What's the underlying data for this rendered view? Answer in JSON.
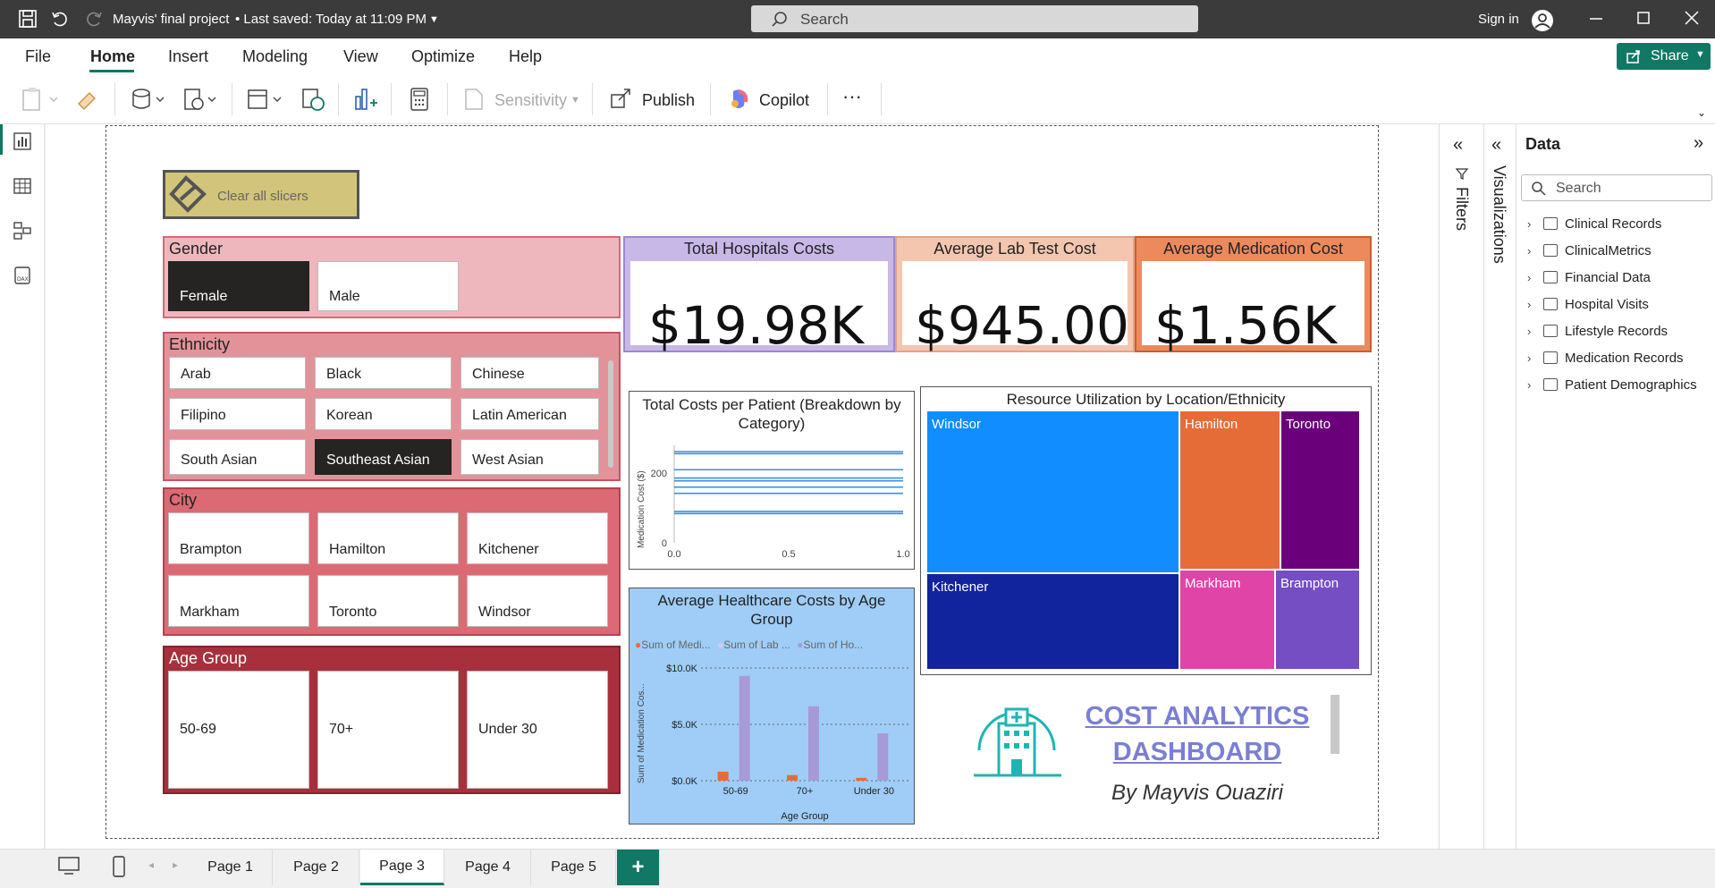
{
  "titlebar": {
    "doc_title": "Mayvis' final project",
    "saved": "• Last saved: Today at 11:09 PM",
    "search_placeholder": "Search",
    "sign_in": "Sign in"
  },
  "menu": {
    "items": [
      "File",
      "Home",
      "Insert",
      "Modeling",
      "View",
      "Optimize",
      "Help"
    ],
    "active": "Home",
    "share_label": "Share"
  },
  "ribbon": {
    "sensitivity": "Sensitivity",
    "publish": "Publish",
    "copilot": "Copilot",
    "more": "···"
  },
  "canvas": {
    "clear_slicers": "Clear all slicers",
    "gender": {
      "title": "Gender",
      "options": [
        "Female",
        "Male"
      ],
      "selected": "Female"
    },
    "ethnicity": {
      "title": "Ethnicity",
      "options": [
        "Arab",
        "Black",
        "Chinese",
        "Filipino",
        "Korean",
        "Latin American",
        "South Asian",
        "Southeast Asian",
        "West Asian"
      ],
      "selected": "Southeast Asian"
    },
    "city": {
      "title": "City",
      "options": [
        "Brampton",
        "Hamilton",
        "Kitchener",
        "Markham",
        "Toronto",
        "Windsor"
      ]
    },
    "age_group": {
      "title": "Age Group",
      "options": [
        "50-69",
        "70+",
        "Under 30"
      ]
    },
    "kpis": [
      {
        "title": "Total Hospitals Costs",
        "value": "$19.98K",
        "color": "#c8b8e8"
      },
      {
        "title": "Average Lab Test Cost",
        "value": "$945.00",
        "color": "#f4c6b0"
      },
      {
        "title": "Average Medication Cost",
        "value": "$1.56K",
        "color": "#ec8a5e"
      }
    ],
    "line_chart": {
      "title": "Total Costs per Patient (Breakdown by Category)",
      "ylabel": "Medication Cost ($)",
      "yticks": [
        "200",
        "0"
      ],
      "xticks": [
        "0.0",
        "0.5",
        "1.0"
      ]
    },
    "treemap": {
      "title": "Resource Utilization by Location/Ethnicity",
      "cells": [
        {
          "label": "Windsor",
          "color": "#118dff"
        },
        {
          "label": "Hamilton",
          "color": "#e66c37"
        },
        {
          "label": "Toronto",
          "color": "#6b007b"
        },
        {
          "label": "Kitchener",
          "color": "#12239e"
        },
        {
          "label": "Markham",
          "color": "#e044a7"
        },
        {
          "label": "Brampton",
          "color": "#744ec2"
        }
      ]
    },
    "bar_chart": {
      "title": "Average Healthcare Costs by Age Group",
      "legend": [
        "Sum of Medi...",
        "Sum of Lab ...",
        "Sum of Ho..."
      ],
      "ylabel": "Sum of Medication Cos...",
      "xlabel": "Age Group",
      "yticks": [
        "$10.0K",
        "$5.0K",
        "$0.0K"
      ]
    },
    "branding": {
      "title_line1": "COST ANALYTICS",
      "title_line2": "DASHBOARD",
      "author": "By Mayvis Ouaziri"
    }
  },
  "chart_data": [
    {
      "type": "bar",
      "title": "Average Healthcare Costs by Age Group",
      "xlabel": "Age Group",
      "ylabel": "Sum of Medication Cos...",
      "categories": [
        "50-69",
        "70+",
        "Under 30"
      ],
      "ylim": [
        0,
        10000
      ],
      "series": [
        {
          "name": "Sum of Medi...",
          "color": "#e66c37",
          "values": [
            800,
            500,
            250
          ]
        },
        {
          "name": "Sum of Lab ...",
          "color": "#d9c8ec",
          "values": [
            0,
            0,
            0
          ]
        },
        {
          "name": "Sum of Ho...",
          "color": "#a89ad6",
          "values": [
            9300,
            6600,
            4200
          ]
        }
      ]
    },
    {
      "type": "line",
      "title": "Total Costs per Patient (Breakdown by Category)",
      "ylabel": "Medication Cost ($)",
      "xlim": [
        0,
        1
      ],
      "ylim": [
        0,
        280
      ],
      "series_levels": [
        262,
        256,
        210,
        186,
        178,
        160,
        142,
        90,
        84
      ]
    }
  ],
  "pages": {
    "tabs": [
      "Page 1",
      "Page 2",
      "Page 3",
      "Page 4",
      "Page 5"
    ],
    "active": "Page 3",
    "add": "+"
  },
  "panes": {
    "filters": "Filters",
    "visualizations": "Visualizations",
    "data_title": "Data",
    "data_search": "Search",
    "tables": [
      "Clinical Records",
      "ClinicalMetrics",
      "Financial Data",
      "Hospital Visits",
      "Lifestyle Records",
      "Medication Records",
      "Patient Demographics"
    ]
  }
}
